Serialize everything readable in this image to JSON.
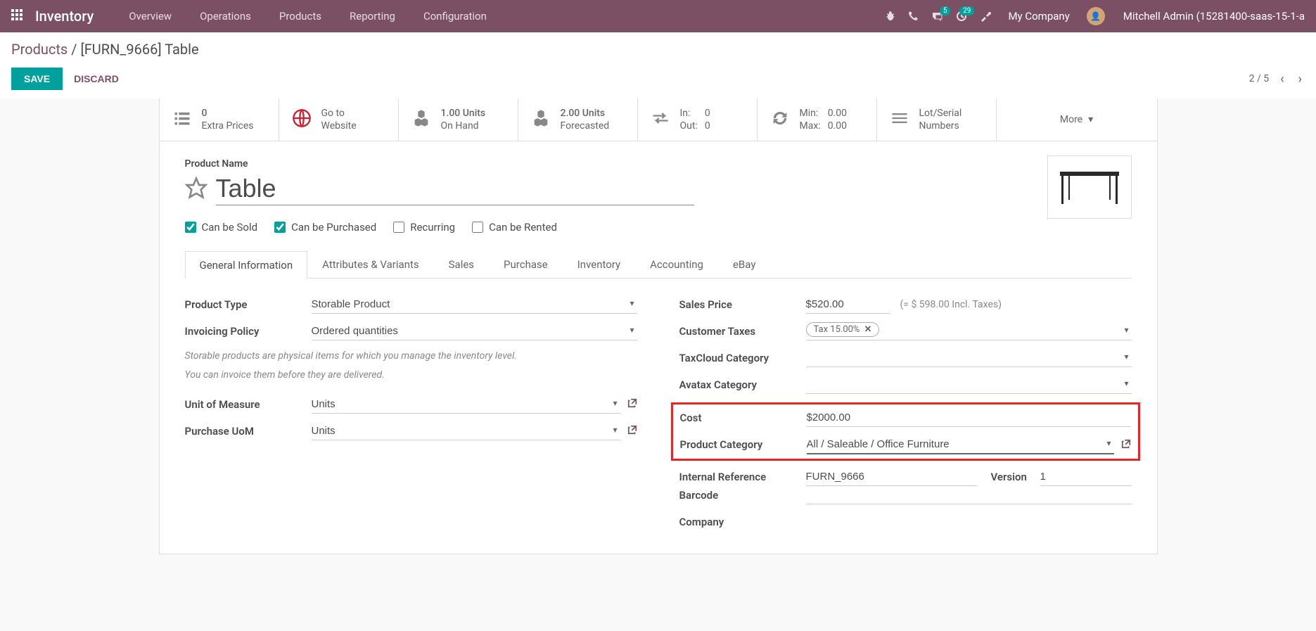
{
  "topbar": {
    "app": "Inventory",
    "nav": [
      "Overview",
      "Operations",
      "Products",
      "Reporting",
      "Configuration"
    ],
    "msg_badge": "5",
    "activity_badge": "29",
    "company": "My Company",
    "user": "Mitchell Admin (15281400-saas-15-1-a"
  },
  "breadcrumb": {
    "parent": "Products",
    "sep": " / ",
    "current": "[FURN_9666] Table"
  },
  "actions": {
    "save": "Save",
    "discard": "Discard"
  },
  "pager": {
    "text": "2 / 5"
  },
  "stats": {
    "extra_prices": {
      "val": "0",
      "label": "Extra Prices"
    },
    "website": {
      "l1": "Go to",
      "l2": "Website"
    },
    "on_hand": {
      "val": "1.00 Units",
      "label": "On Hand"
    },
    "forecast": {
      "val": "2.00 Units",
      "label": "Forecasted"
    },
    "inout": {
      "in_k": "In:",
      "in_v": "0",
      "out_k": "Out:",
      "out_v": "0"
    },
    "minmax": {
      "min_k": "Min:",
      "min_v": "0.00",
      "max_k": "Max:",
      "max_v": "0.00"
    },
    "lot": {
      "l1": "Lot/Serial",
      "l2": "Numbers"
    },
    "more": "More"
  },
  "product": {
    "name_label": "Product Name",
    "name": "Table",
    "checks": {
      "sold": "Can be Sold",
      "purchased": "Can be Purchased",
      "recurring": "Recurring",
      "rented": "Can be Rented"
    }
  },
  "tabs": [
    "General Information",
    "Attributes & Variants",
    "Sales",
    "Purchase",
    "Inventory",
    "Accounting",
    "eBay"
  ],
  "fields": {
    "product_type": {
      "label": "Product Type",
      "value": "Storable Product"
    },
    "invoicing_policy": {
      "label": "Invoicing Policy",
      "value": "Ordered quantities"
    },
    "help1": "Storable products are physical items for which you manage the inventory level.",
    "help2": "You can invoice them before they are delivered.",
    "uom": {
      "label": "Unit of Measure",
      "value": "Units"
    },
    "purchase_uom": {
      "label": "Purchase UoM",
      "value": "Units"
    },
    "sales_price": {
      "label": "Sales Price",
      "value": "$520.00",
      "incl": "(= $ 598.00 Incl. Taxes)"
    },
    "customer_taxes": {
      "label": "Customer Taxes",
      "tag": "Tax 15.00%"
    },
    "taxcloud": {
      "label": "TaxCloud Category"
    },
    "avatax": {
      "label": "Avatax Category"
    },
    "cost": {
      "label": "Cost",
      "value": "$2000.00"
    },
    "category": {
      "label": "Product Category",
      "value": "All / Saleable / Office Furniture"
    },
    "ref": {
      "label": "Internal Reference",
      "value": "FURN_9666"
    },
    "version": {
      "label": "Version",
      "value": "1"
    },
    "barcode": {
      "label": "Barcode"
    },
    "company": {
      "label": "Company"
    }
  }
}
